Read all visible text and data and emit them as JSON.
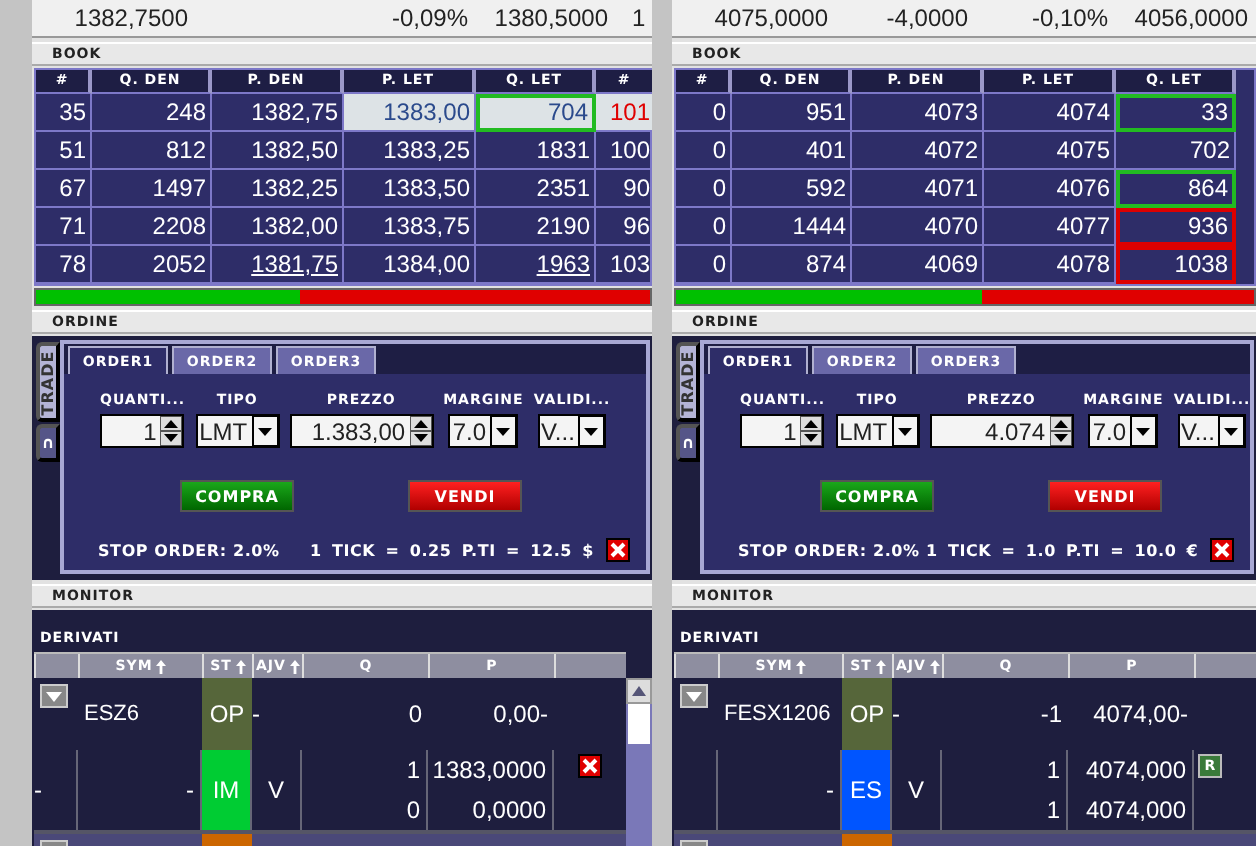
{
  "panels": [
    {
      "quote": [
        {
          "kind": "last",
          "text": "1382,7500"
        },
        {
          "kind": "percent",
          "text": "-0,09%"
        },
        {
          "kind": "min",
          "text": "1380,5000"
        },
        {
          "kind": "max",
          "text": "1"
        }
      ],
      "book": {
        "title": "BOOK",
        "columns": [
          "#",
          "Q. DEN",
          "P. DEN",
          "P. LET",
          "Q. LET",
          "#"
        ],
        "rows": [
          {
            "cells": [
              "35",
              "248",
              "1382,75",
              "1383,00",
              "704",
              "101"
            ],
            "highlight": true,
            "color": "#22bb22",
            "alert": true,
            "underlined": false
          },
          {
            "cells": [
              "51",
              "812",
              "1382,50",
              "1383,25",
              "1831",
              "100"
            ],
            "highlight": false,
            "alert": false,
            "underlined": false
          },
          {
            "cells": [
              "67",
              "1497",
              "1382,25",
              "1383,50",
              "2351",
              "90"
            ],
            "highlight": false,
            "alert": false,
            "underlined": false
          },
          {
            "cells": [
              "71",
              "2208",
              "1382,00",
              "1383,75",
              "2190",
              "96"
            ],
            "highlight": false,
            "alert": false,
            "underlined": false
          },
          {
            "cells": [
              "78",
              "2052",
              "1381,75",
              "1384,00",
              "1963",
              "103"
            ],
            "highlight": false,
            "alert": false,
            "underlined": true
          }
        ],
        "level": 0.43
      },
      "order": {
        "title": "ORDINE",
        "side_tabs": [
          {
            "label": "TRADE",
            "selected": true
          },
          {
            "label": "∩",
            "selected": false
          }
        ],
        "tabs": [
          {
            "label": "ORDER1",
            "selected": true
          },
          {
            "label": "ORDER2",
            "selected": false
          },
          {
            "label": "ORDER3",
            "selected": false
          }
        ],
        "fields": [
          {
            "kind": "spin",
            "label": "QUANTI...",
            "value": "1"
          },
          {
            "kind": "select",
            "label": "TIPO",
            "value": "LMT"
          },
          {
            "kind": "spin",
            "label": "PREZZO",
            "value": "1.383,00"
          },
          {
            "kind": "select",
            "label": "MARGINE",
            "value": "7.0"
          },
          {
            "kind": "select",
            "label": "VALIDI...",
            "value": "V..."
          }
        ],
        "buy_button": "COMPRA",
        "sell_button": "VENDI",
        "stop_order": "STOP ORDER: 2.0%",
        "tick_info": "1 TICK = 0.25 P.TI = 12.5 $"
      },
      "monitor": {
        "title": "MONITOR",
        "group": "DERIVATI",
        "columns": [
          "SYM",
          "ST",
          "AJV",
          "Q",
          "P"
        ],
        "scrollbar": true,
        "positions": [
          {
            "symbol": "ESZ6",
            "status": "OP",
            "color": "#56663a",
            "ajv": "-",
            "q": "0",
            "p": "0,00-",
            "orders": [
              {
                "lead": "-",
                "symbol": "-",
                "status": "IM",
                "color": "#00cc33",
                "ajv": "V",
                "q": [
                  "1",
                  "0"
                ],
                "p": [
                  "1383,0000",
                  "0,0000"
                ],
                "action": {
                  "kind": "cancel"
                }
              }
            ]
          },
          {
            "color": "#cc6600"
          }
        ]
      }
    },
    {
      "quote": [
        {
          "kind": "last",
          "text": "4075,0000"
        },
        {
          "kind": "change",
          "text": "-4,0000"
        },
        {
          "kind": "percent",
          "text": "-0,10%"
        },
        {
          "kind": "min",
          "text": "4056,0000"
        }
      ],
      "book": {
        "title": "BOOK",
        "columns": [
          "#",
          "Q. DEN",
          "P. DEN",
          "P. LET",
          "Q. LET"
        ],
        "rows": [
          {
            "cells": [
              "0",
              "951",
              "4073",
              "4074",
              "33"
            ],
            "highlight": false,
            "color": "#22bb22",
            "alert": false,
            "underlined": false
          },
          {
            "cells": [
              "0",
              "401",
              "4072",
              "4075",
              "702"
            ],
            "highlight": false,
            "alert": false,
            "underlined": false
          },
          {
            "cells": [
              "0",
              "592",
              "4071",
              "4076",
              "864"
            ],
            "highlight": false,
            "color": "#22bb22",
            "alert": false,
            "underlined": false
          },
          {
            "cells": [
              "0",
              "1444",
              "4070",
              "4077",
              "936"
            ],
            "highlight": false,
            "color": "#dd0000",
            "alert": false,
            "underlined": false
          },
          {
            "cells": [
              "0",
              "874",
              "4069",
              "4078",
              "1038"
            ],
            "highlight": false,
            "color": "#dd0000",
            "alert": false,
            "underlined": false
          }
        ],
        "level": 0.53
      },
      "order": {
        "title": "ORDINE",
        "side_tabs": [
          {
            "label": "TRADE",
            "selected": true
          },
          {
            "label": "∩",
            "selected": false
          }
        ],
        "tabs": [
          {
            "label": "ORDER1",
            "selected": true
          },
          {
            "label": "ORDER2",
            "selected": false
          },
          {
            "label": "ORDER3",
            "selected": false
          }
        ],
        "fields": [
          {
            "kind": "spin",
            "label": "QUANTI...",
            "value": "1"
          },
          {
            "kind": "select",
            "label": "TIPO",
            "value": "LMT"
          },
          {
            "kind": "spin",
            "label": "PREZZO",
            "value": "4.074"
          },
          {
            "kind": "select",
            "label": "MARGINE",
            "value": "7.0"
          },
          {
            "kind": "select",
            "label": "VALIDI...",
            "value": "V..."
          }
        ],
        "buy_button": "COMPRA",
        "sell_button": "VENDI",
        "stop_order": "STOP ORDER: 2.0%",
        "tick_info": "1 TICK = 1.0 P.TI = 10.0 €"
      },
      "monitor": {
        "title": "MONITOR",
        "group": "DERIVATI",
        "columns": [
          "SYM",
          "ST",
          "AJV",
          "Q",
          "P"
        ],
        "scrollbar": false,
        "positions": [
          {
            "symbol": "FESX1206",
            "status": "OP",
            "color": "#56663a",
            "ajv": "-",
            "q": "-1",
            "p": "4074,00-",
            "orders": [
              {
                "symbol": "-",
                "status": "ES",
                "color": "#0055ff",
                "ajv": "V",
                "q": [
                  "1",
                  "1"
                ],
                "p": [
                  "4074,000",
                  "4074,000"
                ],
                "action": {
                  "kind": "text",
                  "label": "R"
                }
              }
            ]
          },
          {
            "color": "#cc6600"
          }
        ]
      }
    }
  ]
}
